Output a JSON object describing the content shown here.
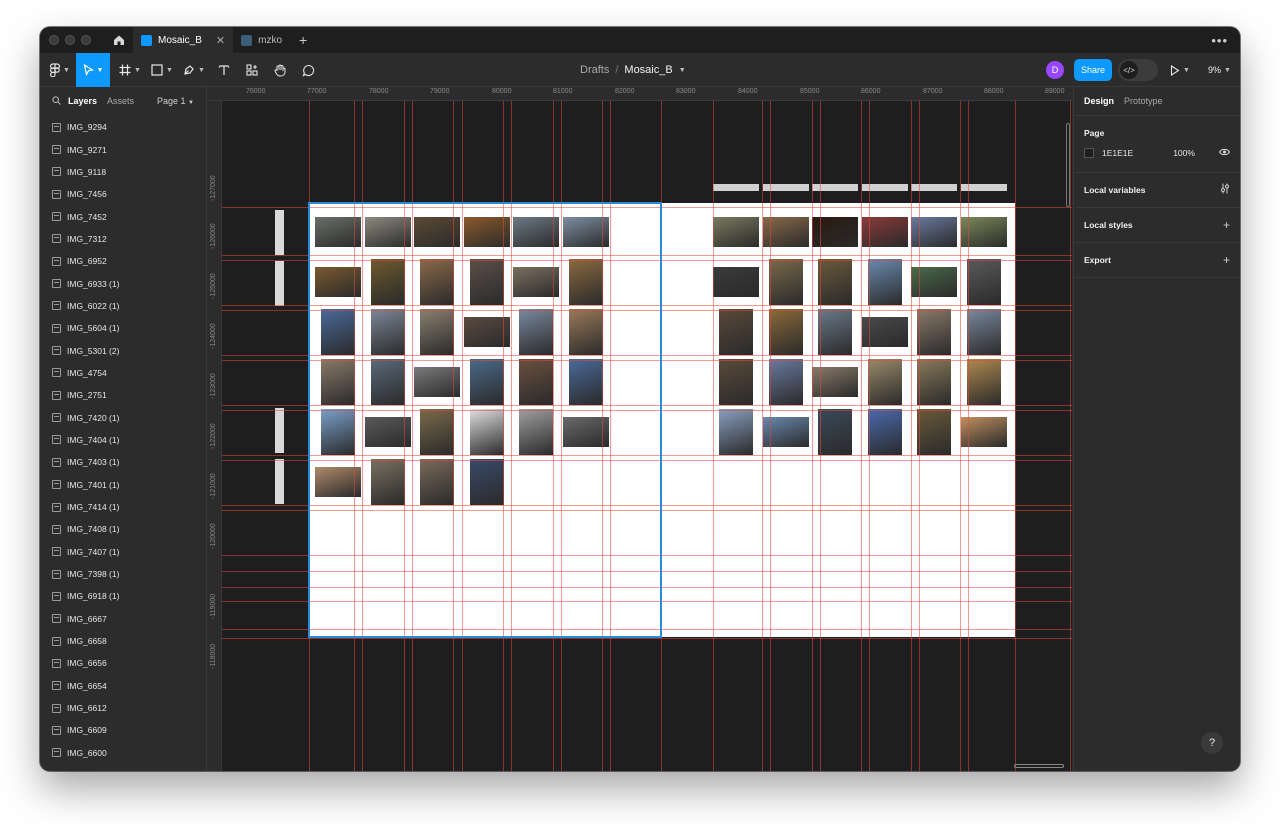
{
  "titlebar": {
    "tabs": [
      {
        "label": "Mosaic_B",
        "active": true
      },
      {
        "label": "mzko",
        "active": false
      }
    ],
    "new_tab_icon": "plus-icon",
    "more_icon": "ellipsis-icon"
  },
  "toolbar": {
    "breadcrumb": {
      "drafts": "Drafts",
      "separator": "/",
      "file": "Mosaic_B"
    },
    "avatar_initial": "D",
    "share_label": "Share",
    "zoom": "9%",
    "tools": [
      "figma-menu-icon",
      "move-icon",
      "frame-icon",
      "rectangle-icon",
      "pen-icon",
      "text-icon",
      "resources-icon",
      "hand-icon",
      "comment-icon"
    ]
  },
  "left_panel": {
    "tab_layers": "Layers",
    "tab_assets": "Assets",
    "page_selector": "Page 1",
    "layers": [
      "IMG_9294",
      "IMG_9271",
      "IMG_9118",
      "IMG_7456",
      "IMG_7452",
      "IMG_7312",
      "IMG_6952",
      "IMG_6933 (1)",
      "IMG_6022 (1)",
      "IMG_5604 (1)",
      "IMG_5301 (2)",
      "IMG_4754",
      "IMG_2751",
      "IMG_7420 (1)",
      "IMG_7404 (1)",
      "IMG_7403 (1)",
      "IMG_7401 (1)",
      "IMG_7414 (1)",
      "IMG_7408 (1)",
      "IMG_7407 (1)",
      "IMG_7398 (1)",
      "IMG_6918 (1)",
      "IMG_6667",
      "IMG_6658",
      "IMG_6656",
      "IMG_6654",
      "IMG_6612",
      "IMG_6609",
      "IMG_6600"
    ]
  },
  "canvas": {
    "ruler_x": [
      "76000",
      "77000",
      "78000",
      "79000",
      "80000",
      "81000",
      "82000",
      "83000",
      "84000",
      "85000",
      "86000",
      "87000",
      "88000",
      "89000"
    ],
    "ruler_y": [
      "-127000",
      "-126000",
      "-125000",
      "-124000",
      "-123000",
      "-122000",
      "-121000",
      "-120000",
      "-119000",
      "-118000"
    ],
    "left_frame_photos": [
      [
        "#6a6f68",
        "#8d8a7e",
        "#5b4a35",
        "#8a5a2a",
        "#6c7a86",
        "#7d8fa3"
      ],
      [
        "#7a5a30",
        "#6d5a2e",
        "#8a6a4a",
        "#5a5048",
        "#7a7060",
        "#8a6a40"
      ],
      [
        "#4a6a9a",
        "#7c8898",
        "#8a8070",
        "#5a4a40",
        "#7a8aa0",
        "#9a7a5a"
      ],
      [
        "#8a7a6a",
        "#5a6a7a",
        "#7a7a7a",
        "#4a6a8a",
        "#6a5040",
        "#4a6a9a"
      ],
      [
        "#7aa0cc",
        "#5a5a5a",
        "#7a6a4a",
        "#e0e0e0",
        "#a0a0a0",
        "#6a6a6a"
      ],
      [
        "#b08a6a",
        "#7a7060",
        "#7a6a5a",
        "#3a4a6a"
      ]
    ],
    "right_frame_photos": [
      [
        "#7a7a60",
        "#8a6a4a",
        "#2a1a10",
        "#8a3a3a",
        "#6a7aa0",
        "#7a8a5a"
      ],
      [
        "#3a3a3a",
        "#7a6a4a",
        "#6a5a3a",
        "#6a8ab0",
        "#4a6a4a",
        "#5a5a5a"
      ],
      [
        "#5a4a3a",
        "#8a6a3a",
        "#6a7a8a",
        "#4a4a4a",
        "#8a7a6a",
        "#7a8aa0"
      ],
      [
        "#5a4a3a",
        "#6a7aa0",
        "#8a7a6a",
        "#9a8a6a",
        "#8a7a5a",
        "#b08a50"
      ],
      [
        "#8aa0c0",
        "#6a8ab0",
        "#3a4a5a",
        "#4a6ab0",
        "#6a5a3a",
        "#c09060"
      ]
    ]
  },
  "right_panel": {
    "tab_design": "Design",
    "tab_prototype": "Prototype",
    "page_section": "Page",
    "page_color": "1E1E1E",
    "page_opacity": "100%",
    "local_variables": "Local variables",
    "local_styles": "Local styles",
    "export": "Export",
    "help": "?"
  }
}
